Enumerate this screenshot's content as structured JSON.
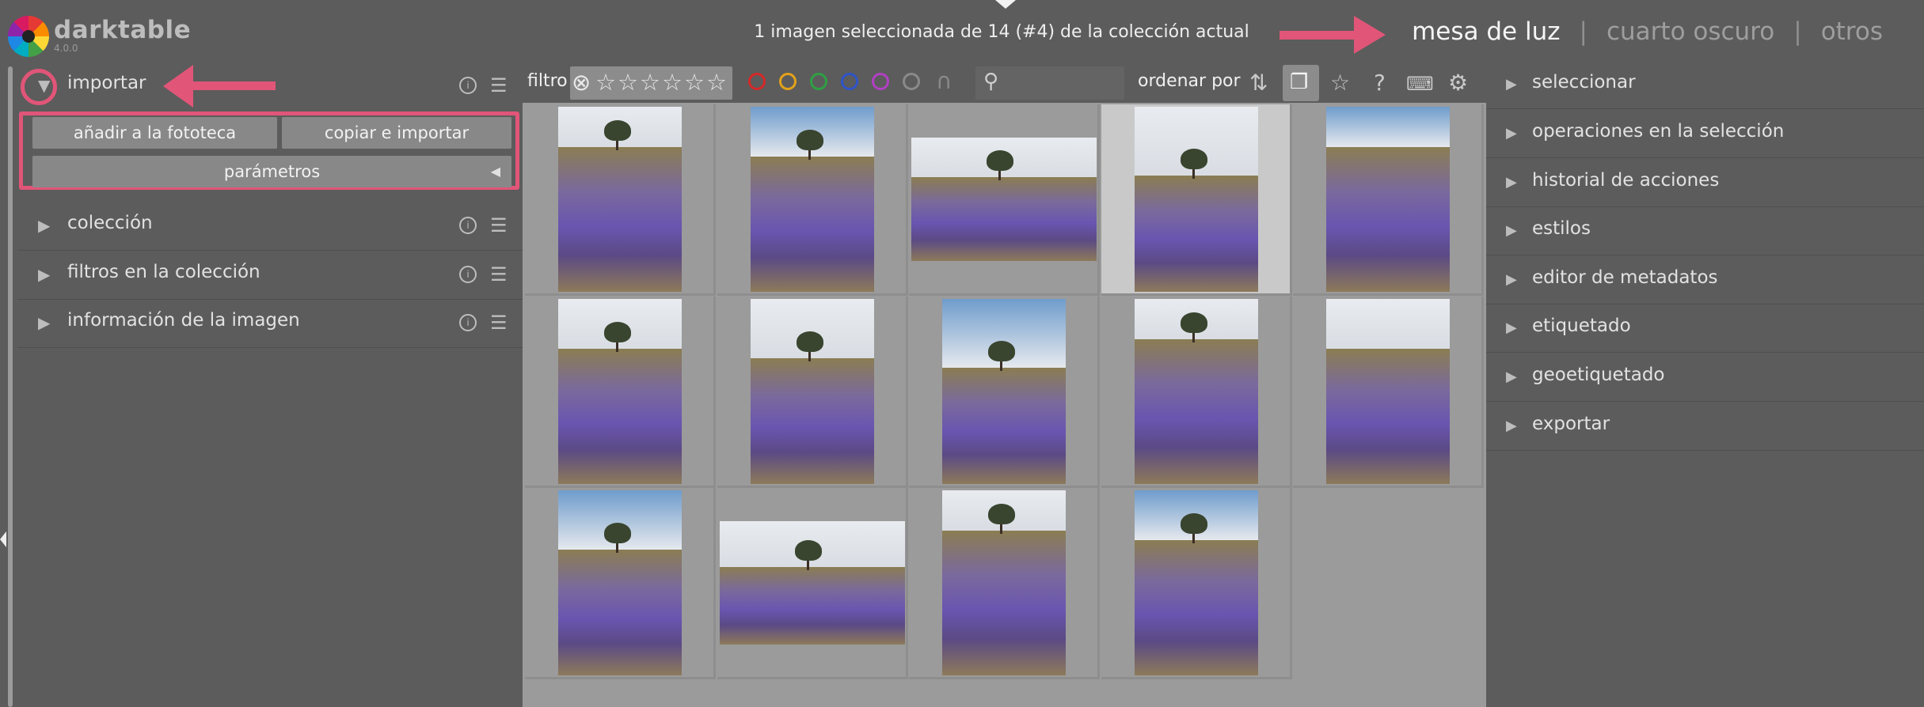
{
  "app": {
    "name": "darktable",
    "version": "4.0.0"
  },
  "header": {
    "selection_status": "1 imagen seleccionada de 14 (#4) de la colección actual",
    "views": [
      {
        "label": "mesa de luz",
        "active": true
      },
      {
        "label": "cuarto oscuro",
        "active": false
      },
      {
        "label": "otros",
        "active": false
      }
    ],
    "separator": "|"
  },
  "left_panel": {
    "modules": [
      {
        "label": "importar",
        "expanded": true
      },
      {
        "label": "colección",
        "expanded": false
      },
      {
        "label": "filtros en la colección",
        "expanded": false
      },
      {
        "label": "información de la imagen",
        "expanded": false
      }
    ],
    "import": {
      "add_to_library": "añadir a la fototeca",
      "copy_and_import": "copiar e importar",
      "parameters": "parámetros"
    },
    "info_icon": "info-icon",
    "menu_icon": "hamburger-menu-icon"
  },
  "filter_bar": {
    "filter_label": "filtro",
    "sort_label": "ordenar por",
    "search_placeholder": "",
    "color_labels": [
      "#d62828",
      "#e3a21a",
      "#2ea043",
      "#2f54c9",
      "#b23fc4"
    ],
    "icons": [
      "reject-icon",
      "star-icon",
      "search-icon",
      "sort-order-icon",
      "grouping-icon",
      "overlay-star-icon",
      "help-icon",
      "keyboard-icon",
      "gear-icon"
    ]
  },
  "lighttable": {
    "selected_index": 4,
    "images": [
      {
        "n": 1,
        "orientation": "portrait"
      },
      {
        "n": 2,
        "orientation": "portrait"
      },
      {
        "n": 3,
        "orientation": "landscape"
      },
      {
        "n": 4,
        "orientation": "portrait"
      },
      {
        "n": 5,
        "orientation": "portrait"
      },
      {
        "n": 6,
        "orientation": "portrait"
      },
      {
        "n": 7,
        "orientation": "portrait"
      },
      {
        "n": 8,
        "orientation": "portrait"
      },
      {
        "n": 9,
        "orientation": "portrait"
      },
      {
        "n": 10,
        "orientation": "portrait"
      },
      {
        "n": 11,
        "orientation": "portrait"
      },
      {
        "n": 12,
        "orientation": "landscape"
      },
      {
        "n": 13,
        "orientation": "portrait"
      },
      {
        "n": 14,
        "orientation": "portrait"
      }
    ]
  },
  "right_panel": {
    "modules": [
      "seleccionar",
      "operaciones en la selección",
      "historial de acciones",
      "estilos",
      "editor de metadatos",
      "etiquetado",
      "geoetiquetado",
      "exportar"
    ]
  },
  "annotation_color": "#e15578"
}
